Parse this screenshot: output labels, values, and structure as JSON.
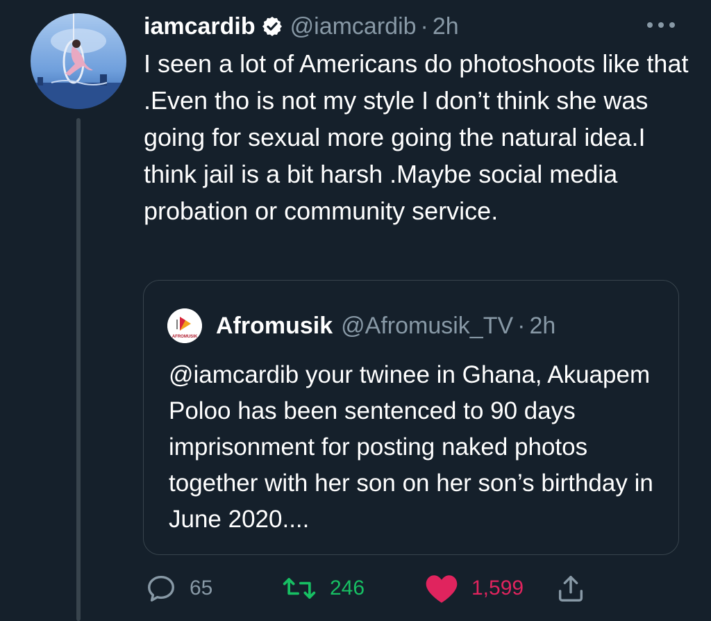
{
  "tweet": {
    "display_name": "iamcardib",
    "handle": "@iamcardib",
    "separator": "·",
    "time": "2h",
    "text": "I seen a lot of Americans do photoshoots like that .Even tho is not my style I don’t think she was going for sexual more going the natural idea.I think jail is a bit harsh .Maybe social media probation or community service.",
    "verified": true,
    "avatar_icon": "profile-photo",
    "more_icon": "more-horizontal-icon"
  },
  "quote": {
    "display_name": "Afromusik",
    "handle": "@Afromusik_TV",
    "separator": "·",
    "time": "2h",
    "avatar_label": "AFROMUSIK",
    "text": "@iamcardib your twinee in Ghana, Akuapem Poloo has been sentenced to 90 days imprisonment for posting naked photos together with her son on her son’s birthday in June 2020...."
  },
  "actions": {
    "reply_count": "65",
    "retweet_count": "246",
    "like_count": "1,599",
    "icons": [
      "reply-icon",
      "retweet-icon",
      "like-icon",
      "share-icon"
    ]
  },
  "colors": {
    "background": "#15202b",
    "secondary_text": "#8899a6",
    "border": "#38444d",
    "retweet": "#17bf63",
    "like": "#e0245e"
  }
}
